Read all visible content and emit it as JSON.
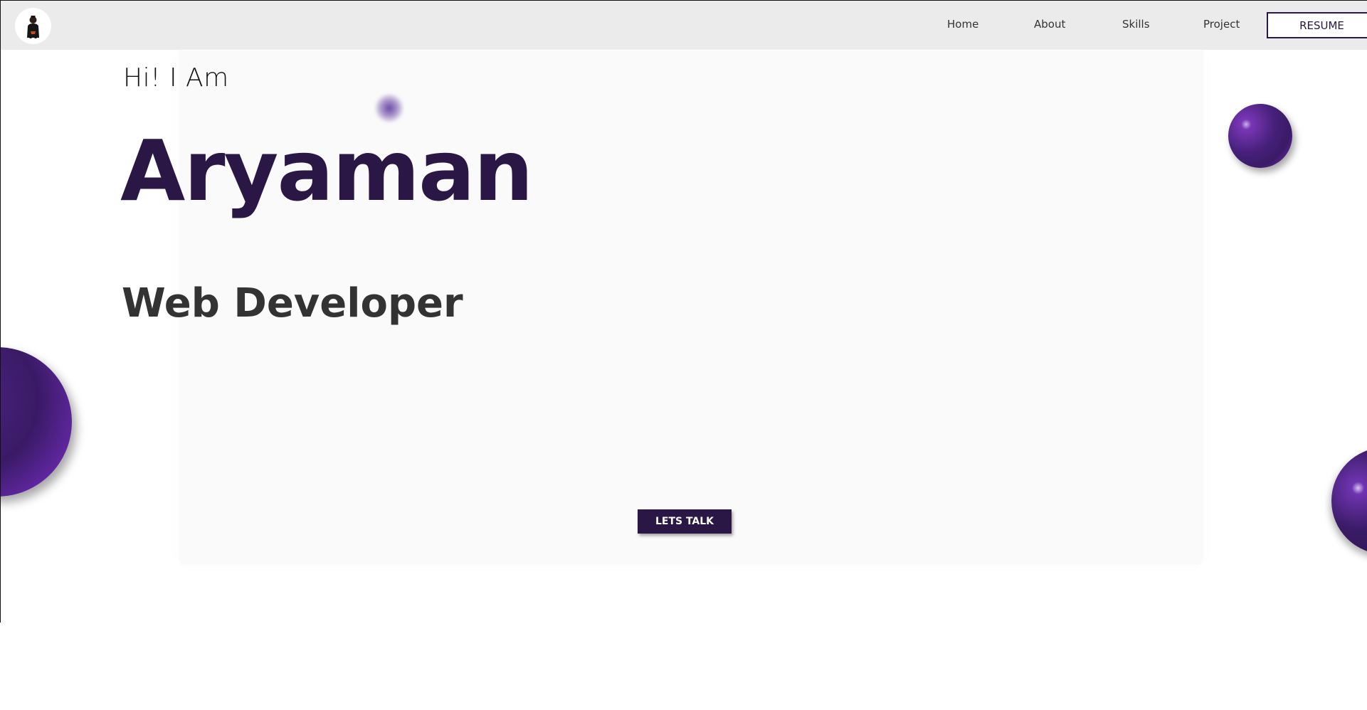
{
  "navbar": {
    "links": [
      {
        "label": "Home"
      },
      {
        "label": "About"
      },
      {
        "label": "Skills"
      },
      {
        "label": "Project"
      }
    ],
    "resume_label": "RESUME",
    "logo_icon": "profile-avatar"
  },
  "hero": {
    "greeting": "Hi! I Am",
    "name": "Aryaman",
    "role": "Web Developer",
    "cta_label": "LETS TALK"
  },
  "colors": {
    "accent": "#2a1745",
    "nav_bg": "#ebebeb",
    "panel_bg": "#fafafa",
    "role_text": "#333333",
    "orb_purple": "#7a36b5"
  }
}
